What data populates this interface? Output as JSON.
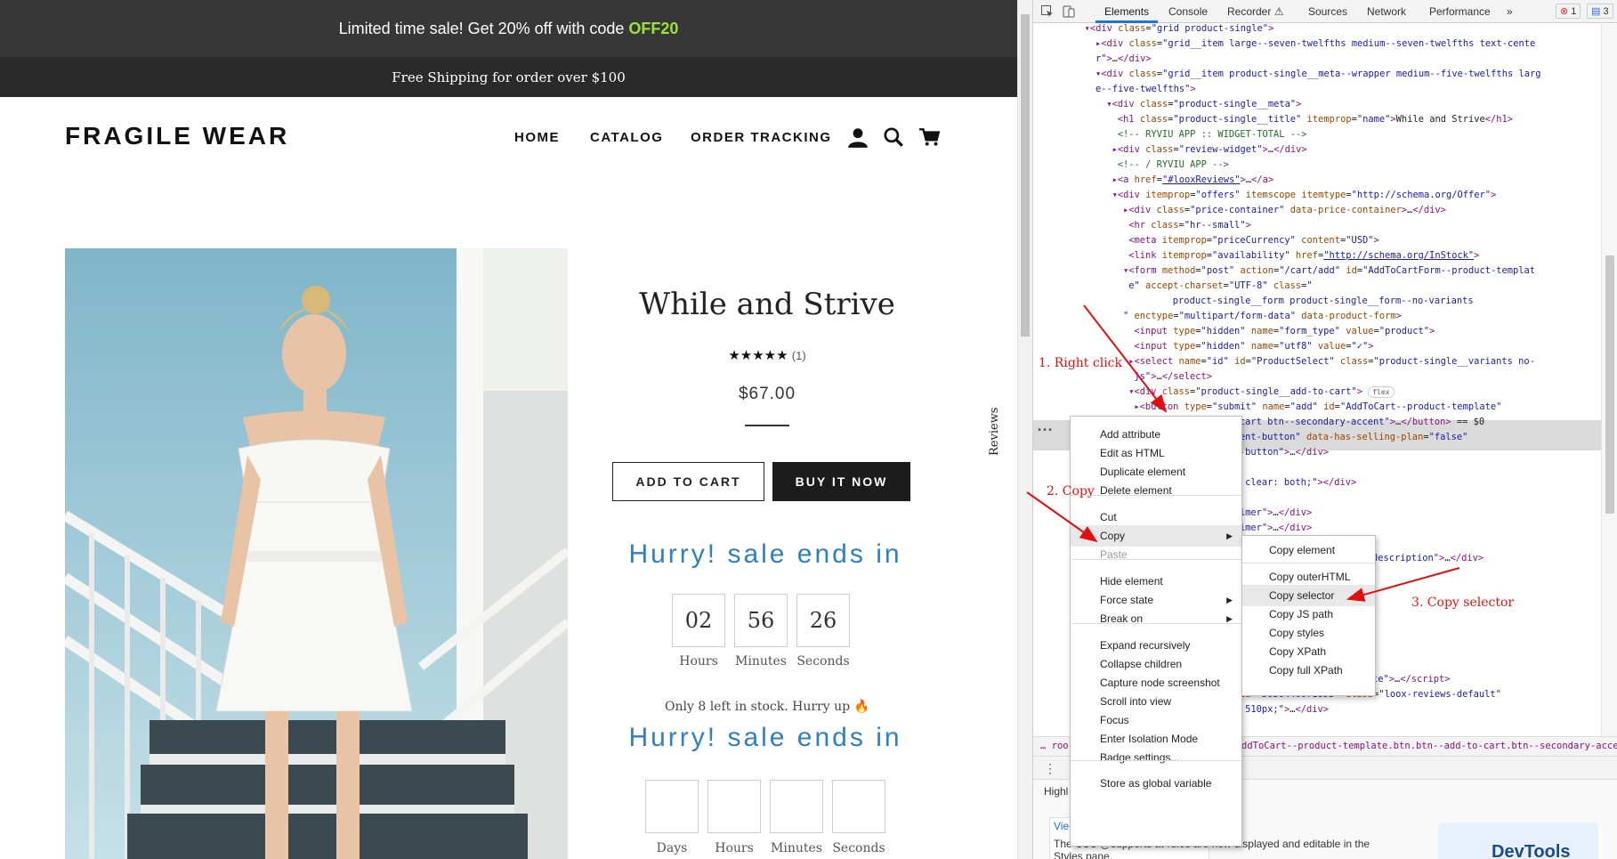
{
  "store": {
    "announcement_text": "Limited time sale! Get 20% off with code",
    "announcement_code": "OFF20",
    "shipping_text": "Free Shipping for order over $100",
    "logo": "FRAGILE WEAR",
    "nav": [
      "HOME",
      "CATALOG",
      "ORDER TRACKING"
    ],
    "reviews_tab": "Reviews",
    "product": {
      "title": "While and Strive",
      "stars": "★★★★★",
      "rating": 5,
      "review_count": "(1)",
      "price": "$67.00",
      "add_to_cart": "ADD TO CART",
      "buy_now": "BUY IT NOW"
    },
    "timer1": {
      "heading": "Hurry! sale ends in",
      "values": [
        "02",
        "56",
        "26"
      ],
      "labels": [
        "Hours",
        "Minutes",
        "Seconds"
      ]
    },
    "stock_text": "Only 8 left in stock. Hurry up 🔥",
    "timer2": {
      "heading": "Hurry! sale ends in",
      "values": [
        "",
        "",
        "",
        ""
      ],
      "labels": [
        "Days",
        "Hours",
        "Minutes",
        "Seconds"
      ]
    }
  },
  "devtools": {
    "tabs": [
      "Elements",
      "Console",
      "Recorder ⚠",
      "Sources",
      "Network",
      "Performance",
      "»"
    ],
    "active_tab": "Elements",
    "errors": "1",
    "messages": "3",
    "dom_lines": [
      {
        "indent": 8,
        "html": "<span class='t'>▾&lt;div</span> <span class='a'>class</span>=<span class='v'>\"grid product-single\"</span><span class='t'>&gt;</span>"
      },
      {
        "indent": 10,
        "html": "<span class='t'>▸&lt;div</span> <span class='a'>class</span>=<span class='v'>\"grid__item large--seven-twelfths medium--seven-twelfths text-cente</span>"
      },
      {
        "indent": 10,
        "html": "<span class='v'>r\"</span><span class='t'>&gt;</span>…<span class='t'>&lt;/div&gt;</span>"
      },
      {
        "indent": 10,
        "html": "<span class='t'>▾&lt;div</span> <span class='a'>class</span>=<span class='v'>\"grid__item product-single__meta--wrapper medium--five-twelfths larg</span>"
      },
      {
        "indent": 10,
        "html": "<span class='v'>e--five-twelfths\"</span><span class='t'>&gt;</span>"
      },
      {
        "indent": 12,
        "html": "<span class='t'>▾&lt;div</span> <span class='a'>class</span>=<span class='v'>\"product-single__meta\"</span><span class='t'>&gt;</span>"
      },
      {
        "indent": 14,
        "html": "<span class='t'>&lt;h1</span> <span class='a'>class</span>=<span class='v'>\"product-single__title\"</span> <span class='a'>itemprop</span>=<span class='v'>\"name\"</span><span class='t'>&gt;</span>While and Strive<span class='t'>&lt;/h1&gt;</span>"
      },
      {
        "indent": 14,
        "html": "<span class='c'>&lt;!-- RYVIU APP :: WIDGET-TOTAL --&gt;</span>"
      },
      {
        "indent": 13,
        "html": "<span class='t'>▸&lt;div</span> <span class='a'>class</span>=<span class='v'>\"review-widget\"</span><span class='t'>&gt;</span>…<span class='t'>&lt;/div&gt;</span>"
      },
      {
        "indent": 14,
        "html": "<span class='c'>&lt;!-- / RYVIU APP --&gt;</span>"
      },
      {
        "indent": 13,
        "html": "<span class='t'>▸&lt;a</span> <span class='a'>href</span>=<span class='lk'>\"#looxReviews\"</span><span class='t'>&gt;</span>…<span class='t'>&lt;/a&gt;</span>"
      },
      {
        "indent": 13,
        "html": "<span class='t'>▾&lt;div</span> <span class='a'>itemprop</span>=<span class='v'>\"offers\"</span> <span class='a'>itemscope</span> <span class='a'>itemtype</span>=<span class='v'>\"http://schema.org/Offer\"</span><span class='t'>&gt;</span>"
      },
      {
        "indent": 15,
        "html": "<span class='t'>▸&lt;div</span> <span class='a'>class</span>=<span class='v'>\"price-container\"</span> <span class='a'>data-price-container</span><span class='t'>&gt;</span>…<span class='t'>&lt;/div&gt;</span>"
      },
      {
        "indent": 16,
        "html": "<span class='t'>&lt;hr</span> <span class='a'>class</span>=<span class='v'>\"hr--small\"</span><span class='t'>&gt;</span>"
      },
      {
        "indent": 16,
        "html": "<span class='t'>&lt;meta</span> <span class='a'>itemprop</span>=<span class='v'>\"priceCurrency\"</span> <span class='a'>content</span>=<span class='v'>\"USD\"</span><span class='t'>&gt;</span>"
      },
      {
        "indent": 16,
        "html": "<span class='t'>&lt;link</span> <span class='a'>itemprop</span>=<span class='v'>\"availability\"</span> <span class='a'>href</span>=<span class='lk'>\"http://schema.org/InStock\"</span><span class='t'>&gt;</span>"
      },
      {
        "indent": 15,
        "html": "<span class='t'>▾&lt;form</span> <span class='a'>method</span>=<span class='v'>\"post\"</span> <span class='a'>action</span>=<span class='v'>\"/cart/add\"</span> <span class='a'>id</span>=<span class='v'>\"AddToCartForm--product-templat</span>"
      },
      {
        "indent": 16,
        "html": "<span class='v'>e\"</span> <span class='a'>accept-charset</span>=<span class='v'>\"UTF-8\"</span> <span class='a'>class</span>=<span class='v'>\"</span>"
      },
      {
        "indent": 24,
        "html": "<span class='v'>product-single__form product-single__form--no-variants</span>"
      },
      {
        "indent": 15,
        "html": "<span class='v'>\"</span> <span class='a'>enctype</span>=<span class='v'>\"multipart/form-data\"</span> <span class='a'>data-product-form</span><span class='t'>&gt;</span>"
      },
      {
        "indent": 17,
        "html": "<span class='t'>&lt;input</span> <span class='a'>type</span>=<span class='v'>\"hidden\"</span> <span class='a'>name</span>=<span class='v'>\"form_type\"</span> <span class='a'>value</span>=<span class='v'>\"product\"</span><span class='t'>&gt;</span>"
      },
      {
        "indent": 17,
        "html": "<span class='t'>&lt;input</span> <span class='a'>type</span>=<span class='v'>\"hidden\"</span> <span class='a'>name</span>=<span class='v'>\"utf8\"</span> <span class='a'>value</span>=<span class='v'>\"✓\"</span><span class='t'>&gt;</span>"
      },
      {
        "indent": 16,
        "html": "<span class='t'>▸&lt;select</span> <span class='a'>name</span>=<span class='v'>\"id\"</span> <span class='a'>id</span>=<span class='v'>\"ProductSelect\"</span> <span class='a'>class</span>=<span class='v'>\"product-single__variants no-</span>"
      },
      {
        "indent": 17,
        "html": "<span class='v'>js\"</span><span class='t'>&gt;</span>…<span class='t'>&lt;/select&gt;</span>"
      },
      {
        "indent": 16,
        "html": "<span class='t'>▾&lt;div</span> <span class='a'>class</span>=<span class='v'>\"product-single__add-to-cart\"</span><span class='t'>&gt;</span> <span class='flex-badge'>flex</span>"
      },
      {
        "indent": 17,
        "html": "<span class='t'>▸&lt;button</span> <span class='a'>type</span>=<span class='v'>\"submit\"</span> <span class='a'>name</span>=<span class='v'>\"add\"</span> <span class='a'>id</span>=<span class='v'>\"AddToCart--product-template\"</span>"
      },
      {
        "indent": 24,
        "html": "<span class='v'>btn--add-to-cart btn--secondary-accent\"</span><span class='t'>&gt;</span>…<span class='t'>&lt;/button&gt;</span> == $0"
      },
      {
        "indent": 24,
        "html": "<span class='v'>shopify-payment-button\"</span> <span class='a'>data-has-selling-plan</span>=<span class='v'>\"false\"</span>"
      },
      {
        "indent": 24,
        "html": "<span class='v'>pify-payment-button\"</span><span class='t'>&gt;</span>…<span class='t'>&lt;/div&gt;</span>"
      },
      {
        "indent": 24,
        "html": ""
      },
      {
        "indent": 24,
        "html": "<span class='v'>width: 100%; clear: both;\"</span><span class='t'>&gt;</span><span class='t'>&lt;/div&gt;</span>"
      },
      {
        "indent": 24,
        "html": ""
      },
      {
        "indent": 24,
        "html": "<span class='v'>-countdown-timer\"</span><span class='t'>&gt;</span>…<span class='t'>&lt;/div&gt;</span>"
      },
      {
        "indent": 24,
        "html": "<span class='v'>-countdown-timer\"</span><span class='t'>&gt;</span>…<span class='t'>&lt;/div&gt;</span>"
      },
      {
        "indent": 24,
        "html": ""
      },
      {
        "indent": 43,
        "html": "<span class='v'>n rte\"</span> <span class='a'>itemprop</span>=<span class='v'>\"description\"</span><span class='t'>&gt;</span>…<span class='t'>&lt;/div&gt;</span>"
      },
      {
        "indent": 43,
        "html": "<span class='t'>-&gt;</span>"
      },
      {
        "indent": 43,
        "html": "<span class='t'>&gt;</span>"
      },
      {
        "indent": 24,
        "html": ""
      },
      {
        "indent": 24,
        "html": ""
      },
      {
        "indent": 24,
        "html": ""
      },
      {
        "indent": 24,
        "html": ""
      },
      {
        "indent": 24,
        "html": ""
      },
      {
        "indent": 43,
        "html": "<span class='v'>on-product-template\"</span><span class='t'>&gt;</span>…<span class='t'>&lt;/script&gt;</span>"
      },
      {
        "indent": 24,
        "html": "<span class='a'>ata-product-id</span>=<span class='v'>\"5030446071853\"</span> <span class='a'>class</span>=<span class='v'>\"loox-reviews-default\"</span>"
      },
      {
        "indent": 24,
        "html": "<span class='a'>yle</span>=<span class='v'>\"height: 510px;\"</span><span class='t'>&gt;</span>…<span class='t'>&lt;/div&gt;</span>"
      }
    ],
    "breadcrumb_left": "… roo",
    "breadcrumb_right": "ddToCart--product-template.btn.btn--add-to-cart.btn--secondary-accent",
    "styles_tab_partial": "Highl",
    "styles_text": "The CSS @supports at-rules are now displayed and editable in the Styles pane.",
    "styles_link": "Vie",
    "devtools_logo_partial": "DevTools"
  },
  "context_menu": {
    "items": [
      "Add attribute",
      "Edit as HTML",
      "Duplicate element",
      "Delete element",
      "Cut",
      "Copy",
      "Paste",
      "Hide element",
      "Force state",
      "Break on",
      "Expand recursively",
      "Collapse children",
      "Capture node screenshot",
      "Scroll into view",
      "Focus",
      "Enter Isolation Mode",
      "Badge settings...",
      "Store as global variable"
    ]
  },
  "copy_submenu": {
    "items": [
      "Copy element",
      "Copy outerHTML",
      "Copy selector",
      "Copy JS path",
      "Copy styles",
      "Copy XPath",
      "Copy full XPath"
    ]
  },
  "annotations": {
    "step1": "1. Right click",
    "step2": "2. Copy",
    "step3": "3. Copy selector"
  },
  "colors": {
    "accent_blue": "#2f7fc1",
    "promo_code_green": "#9be13c",
    "annotation_red": "#e01010"
  }
}
